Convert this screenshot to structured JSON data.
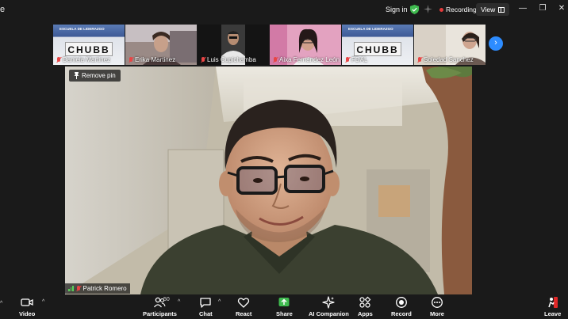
{
  "window": {
    "title_fragment": "e",
    "sign_in": "Sign in",
    "recording": "Recording",
    "view": "View"
  },
  "thumbnails": [
    {
      "name": "Daniela Martinez",
      "kind": "chubb",
      "top": "ESCUELA DE LIDERAZGO",
      "logo": "CHUBB"
    },
    {
      "name": "Erika Martinez",
      "kind": "person"
    },
    {
      "name": "Luis Cupichamba",
      "kind": "person"
    },
    {
      "name": "Aixa Fernández León",
      "kind": "person"
    },
    {
      "name": "FDAL",
      "kind": "chubb",
      "top": "ESCUELA DE LIDERAZGO",
      "logo": "CHUBB"
    },
    {
      "name": "Soledad Sanchez",
      "kind": "person"
    }
  ],
  "main_video": {
    "pin_label": "Remove pin",
    "speaker_name": "Patrick Romero"
  },
  "toolbar": {
    "video": "Video",
    "participants": "Participants",
    "participants_count": "50",
    "chat": "Chat",
    "react": "React",
    "share": "Share",
    "ai_companion": "AI Companion",
    "apps": "Apps",
    "record": "Record",
    "more": "More",
    "leave": "Leave"
  },
  "colors": {
    "accent": "#2d8cff",
    "share_green": "#3fba4f",
    "record_red": "#e33b3b",
    "mic_off": "#e84545",
    "leave_red": "#e02828"
  }
}
